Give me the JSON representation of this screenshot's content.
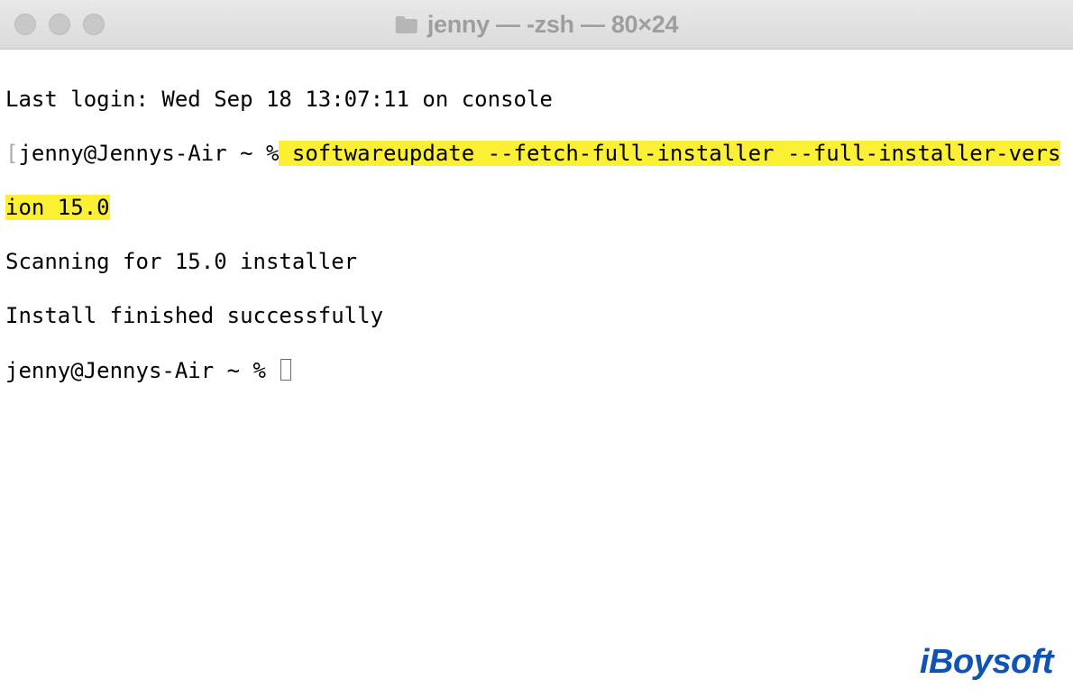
{
  "titlebar": {
    "title": "jenny — -zsh — 80×24"
  },
  "terminal": {
    "last_login": "Last login: Wed Sep 18 13:07:11 on console",
    "prompt_user_host": "jenny@Jennys-Air ~ %",
    "bracket": "[",
    "command_part1": " softwareupdate --fetch-full-installer --full-installer-vers",
    "command_part2": "ion 15.0",
    "output_scan": "Scanning for 15.0 installer",
    "output_finished": "Install finished successfully",
    "prompt2": "jenny@Jennys-Air ~ % "
  },
  "watermark": {
    "text": "iBoysoft"
  }
}
